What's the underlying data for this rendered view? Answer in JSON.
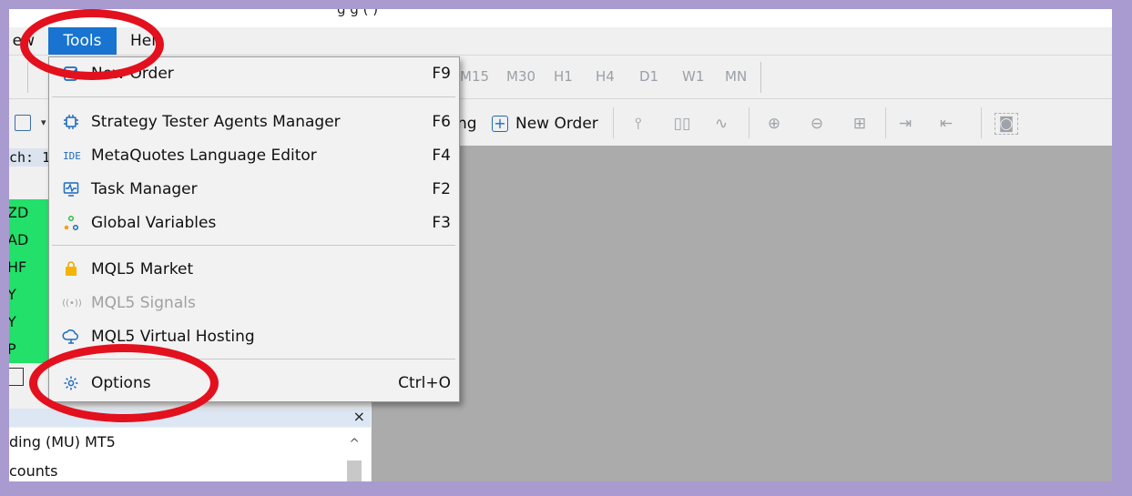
{
  "window": {
    "title_fragment": "g      g (   )"
  },
  "menubar": {
    "view_fragment": "ew",
    "tools": "Tools",
    "help": "Hel"
  },
  "timeframes": [
    "M15",
    "M30",
    "H1",
    "H4",
    "D1",
    "W1",
    "MN"
  ],
  "toolbar": {
    "partial_label": "ng",
    "new_order_label": "New Order"
  },
  "tools_menu": {
    "groups": [
      [
        {
          "label": "New Order",
          "shortcut": "F9",
          "icon": "new-order-icon",
          "enabled": true
        }
      ],
      [
        {
          "label": "Strategy Tester Agents Manager",
          "shortcut": "F6",
          "icon": "chip-icon",
          "enabled": true
        },
        {
          "label": "MetaQuotes Language Editor",
          "shortcut": "F4",
          "icon": "ide-icon",
          "enabled": true
        },
        {
          "label": "Task Manager",
          "shortcut": "F2",
          "icon": "task-manager-icon",
          "enabled": true
        },
        {
          "label": "Global Variables",
          "shortcut": "F3",
          "icon": "global-variables-icon",
          "enabled": true
        }
      ],
      [
        {
          "label": "MQL5 Market",
          "shortcut": "",
          "icon": "shopping-bag-icon",
          "enabled": true
        },
        {
          "label": "MQL5 Signals",
          "shortcut": "",
          "icon": "signals-icon",
          "enabled": false
        },
        {
          "label": "MQL5 Virtual Hosting",
          "shortcut": "",
          "icon": "cloud-icon",
          "enabled": true
        }
      ],
      [
        {
          "label": "Options",
          "shortcut": "Ctrl+O",
          "icon": "gear-icon",
          "enabled": true
        }
      ]
    ],
    "ide_icon_text": "IDE",
    "signals_icon_text": "((•))"
  },
  "market_watch": {
    "search_fragment": "ch: 1",
    "symbols": [
      "ZD",
      "AD",
      "HF",
      "Y",
      "Y",
      "P"
    ]
  },
  "navigator": {
    "close": "×",
    "lines": [
      "ding (MU) MT5",
      "counts"
    ],
    "scroll_up": "^"
  },
  "colors": {
    "menu_highlight": "#1874d0",
    "symbol_bg": "#22e06a",
    "annotation_ring": "#e3101d",
    "frame": "#a99bd0",
    "chart_bg": "#ababab"
  }
}
